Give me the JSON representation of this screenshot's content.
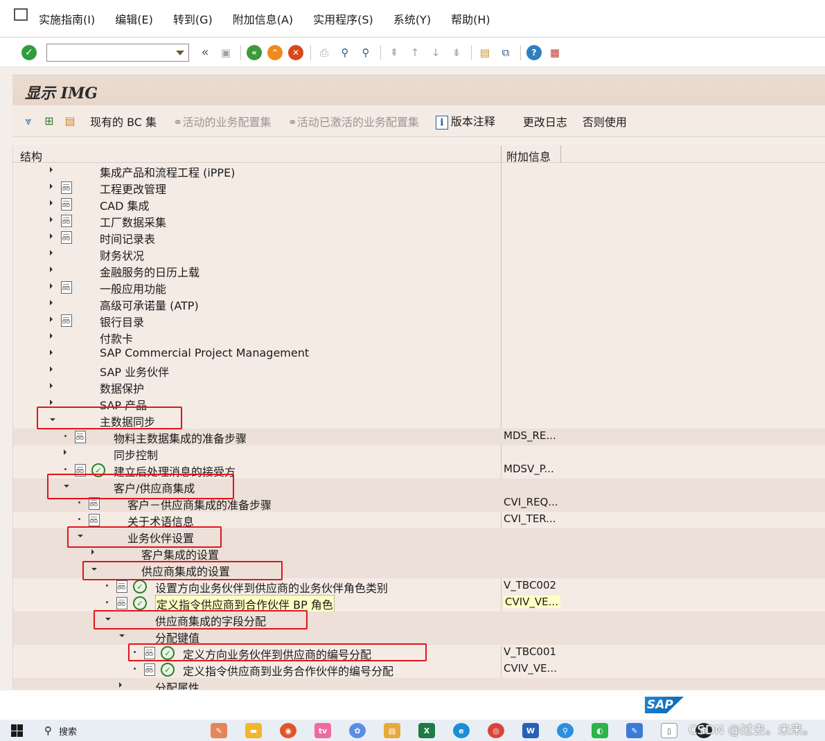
{
  "menu": {
    "items": [
      "实施指南(I)",
      "编辑(E)",
      "转到(G)",
      "附加信息(A)",
      "实用程序(S)",
      "系统(Y)",
      "帮助(H)"
    ]
  },
  "toolbar": {
    "command_value": "",
    "icons": [
      "enter-icon",
      "back-nav-icon",
      "save-icon",
      "back-icon",
      "exit-icon",
      "cancel-icon",
      "print-icon",
      "find-icon",
      "find-next-icon",
      "first-page-icon",
      "prev-page-icon",
      "next-page-icon",
      "last-page-icon",
      "new-session-icon",
      "shortcut-icon",
      "help-icon",
      "customize-layout-icon"
    ]
  },
  "title": "显示 IMG",
  "app_toolbar": {
    "existing_bc_sets": "现有的 BC 集",
    "active_bc_sets": "活动的业务配置集",
    "activated_bc_sets": "活动已激活的业务配置集",
    "release_notes": "版本注释",
    "change_log": "更改日志",
    "otherwise_used": "否则使用"
  },
  "columns": {
    "structure": "结构",
    "additional_info": "附加信息"
  },
  "tree": [
    {
      "label": "集成产品和流程工程 (iPPE)",
      "info": "",
      "level": 0,
      "node": "collapsed",
      "doc": false,
      "exe": false
    },
    {
      "label": "工程更改管理",
      "info": "",
      "level": 0,
      "node": "collapsed",
      "doc": true,
      "exe": false
    },
    {
      "label": "CAD 集成",
      "info": "",
      "level": 0,
      "node": "collapsed",
      "doc": true,
      "exe": false
    },
    {
      "label": "工厂数据采集",
      "info": "",
      "level": 0,
      "node": "collapsed",
      "doc": true,
      "exe": false
    },
    {
      "label": "时间记录表",
      "info": "",
      "level": 0,
      "node": "collapsed",
      "doc": true,
      "exe": false
    },
    {
      "label": "财务状况",
      "info": "",
      "level": 0,
      "node": "collapsed",
      "doc": false,
      "exe": false
    },
    {
      "label": "金融服务的日历上载",
      "info": "",
      "level": 0,
      "node": "collapsed",
      "doc": false,
      "exe": false
    },
    {
      "label": "一般应用功能",
      "info": "",
      "level": 0,
      "node": "collapsed",
      "doc": true,
      "exe": false
    },
    {
      "label": "高级可承诺量 (ATP)",
      "info": "",
      "level": 0,
      "node": "collapsed",
      "doc": false,
      "exe": false
    },
    {
      "label": "银行目录",
      "info": "",
      "level": 0,
      "node": "collapsed",
      "doc": true,
      "exe": false
    },
    {
      "label": "付款卡",
      "info": "",
      "level": 0,
      "node": "collapsed",
      "doc": false,
      "exe": false
    },
    {
      "label": "SAP Commercial Project Management",
      "info": "",
      "level": 0,
      "node": "collapsed",
      "doc": false,
      "exe": false
    },
    {
      "label": "SAP 业务伙伴",
      "info": "",
      "level": 0,
      "node": "collapsed",
      "doc": false,
      "exe": false
    },
    {
      "label": "数据保护",
      "info": "",
      "level": 0,
      "node": "collapsed",
      "doc": false,
      "exe": false
    },
    {
      "label": "SAP 产品",
      "info": "",
      "level": 0,
      "node": "collapsed",
      "doc": false,
      "exe": false
    },
    {
      "label": "主数据同步",
      "info": "",
      "level": 0,
      "node": "expanded",
      "doc": false,
      "exe": false
    },
    {
      "label": "物料主数据集成的准备步骤",
      "info": "MDS_RE...",
      "level": 1,
      "node": "leaf",
      "doc": true,
      "exe": false
    },
    {
      "label": "同步控制",
      "info": "",
      "level": 1,
      "node": "collapsed",
      "doc": false,
      "exe": false
    },
    {
      "label": "建立后处理消息的接受方",
      "info": "MDSV_P...",
      "level": 1,
      "node": "leaf",
      "doc": true,
      "exe": true
    },
    {
      "label": "客户/供应商集成",
      "info": "",
      "level": 1,
      "node": "expanded",
      "doc": false,
      "exe": false
    },
    {
      "label": "客户－供应商集成的准备步骤",
      "info": "CVI_REQ...",
      "level": 2,
      "node": "leaf",
      "doc": true,
      "exe": false
    },
    {
      "label": "关于术语信息",
      "info": "CVI_TER...",
      "level": 2,
      "node": "leaf",
      "doc": true,
      "exe": false
    },
    {
      "label": "业务伙伴设置",
      "info": "",
      "level": 2,
      "node": "expanded",
      "doc": false,
      "exe": false
    },
    {
      "label": "客户集成的设置",
      "info": "",
      "level": 3,
      "node": "collapsed",
      "doc": false,
      "exe": false
    },
    {
      "label": "供应商集成的设置",
      "info": "",
      "level": 3,
      "node": "expanded",
      "doc": false,
      "exe": false
    },
    {
      "label": "设置方向业务伙伴到供应商的业务伙伴角色类别",
      "info": "V_TBC002",
      "level": 4,
      "node": "leaf",
      "doc": true,
      "exe": true
    },
    {
      "label": "定义指令供应商到合作伙伴 BP 角色",
      "info": "CVIV_VE...",
      "level": 4,
      "node": "leaf",
      "doc": true,
      "exe": true,
      "selected": true
    },
    {
      "label": "供应商集成的字段分配",
      "info": "",
      "level": 4,
      "node": "expanded",
      "doc": false,
      "exe": false
    },
    {
      "label": "分配键值",
      "info": "",
      "level": 5,
      "node": "expanded",
      "doc": false,
      "exe": false
    },
    {
      "label": "定义方向业务伙伴到供应商的编号分配",
      "info": "V_TBC001",
      "level": 6,
      "node": "leaf",
      "doc": true,
      "exe": true
    },
    {
      "label": "定义指令供应商到业务合作伙伴的编号分配",
      "info": "CVIV_VE...",
      "level": 6,
      "node": "leaf",
      "doc": true,
      "exe": true
    },
    {
      "label": "分配属性",
      "info": "",
      "level": 5,
      "node": "collapsed",
      "doc": false,
      "exe": false
    }
  ],
  "footer": {
    "sap_logo": "SAP"
  },
  "taskbar": {
    "search": "搜索",
    "apps": [
      "explorer-icon",
      "firefox-icon",
      "bilibili-icon",
      "app-icon",
      "file-manager-icon",
      "excel-icon",
      "edge-icon",
      "chrome-icon",
      "word-icon",
      "search-app-icon",
      "wechat-icon",
      "notes-icon",
      "file-icon",
      "qq-icon"
    ],
    "watermark": "CSDN @过去。未来。"
  },
  "colors": {
    "accent_red_box": "#e0141b",
    "selected_row": "#ffffc4",
    "tree_background": "#f4ebe5"
  }
}
